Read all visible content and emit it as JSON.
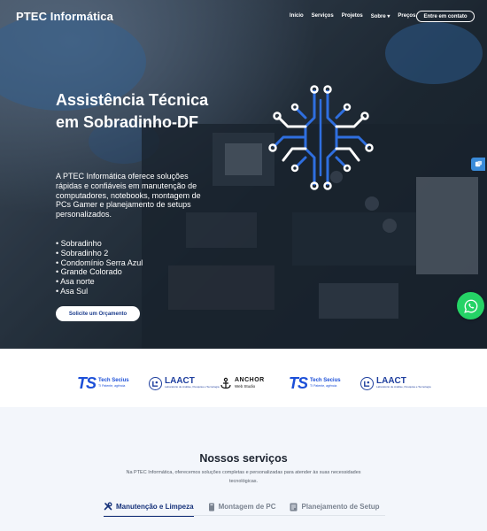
{
  "header": {
    "brand": "PTEC Informática",
    "nav": [
      {
        "label": "Início"
      },
      {
        "label": "Serviços"
      },
      {
        "label": "Projetos"
      },
      {
        "label": "Sobre ▾"
      },
      {
        "label": "Preços"
      }
    ],
    "contact_label": "Entre em contato"
  },
  "hero": {
    "title": "Assistência Técnica em Sobradinho-DF",
    "description": "A PTEC Informática oferece soluções rápidas e confiáveis em manutenção de computadores, notebooks, montagem de PCs Gamer e planejamento de setups personalizados.",
    "locations": [
      "Sobradinho",
      "Sobradinho 2",
      "Condomínio Serra Azul",
      "Grande Colorado",
      "Asa norte",
      "Asa Sul"
    ],
    "cta_label": "Solicite um Orçamento"
  },
  "partners": [
    {
      "icon": "ts",
      "name": "Tech Secius",
      "sub": "TI Patente, agência"
    },
    {
      "icon": "laact",
      "name": "LAACT",
      "sub": "Laboratório de Análise, Pesquisa e Tecnologia"
    },
    {
      "icon": "anchor",
      "name": "ANCHOR",
      "sub": "Web Studio"
    },
    {
      "icon": "ts",
      "name": "Tech Secius",
      "sub": "TI Patente, agência"
    },
    {
      "icon": "laact",
      "name": "LAACT",
      "sub": "Laboratório de Análise, Pesquisa e Tecnologia"
    }
  ],
  "services": {
    "title": "Nossos serviços",
    "description": "Na PTEC Informática, oferecemos soluções completas e personalizadas para atender às suas necessidades tecnológicas.",
    "tabs": [
      {
        "label": "Manutenção e Limpeza",
        "icon": "tools-icon",
        "active": true
      },
      {
        "label": "Montagem de PC",
        "icon": "pc-tower-icon",
        "active": false
      },
      {
        "label": "Planejamento de Setup",
        "icon": "blueprint-icon",
        "active": false
      }
    ]
  },
  "colors": {
    "accent": "#1c4fd8",
    "whatsapp": "#25d366",
    "side_tab": "#3a8bd9"
  }
}
